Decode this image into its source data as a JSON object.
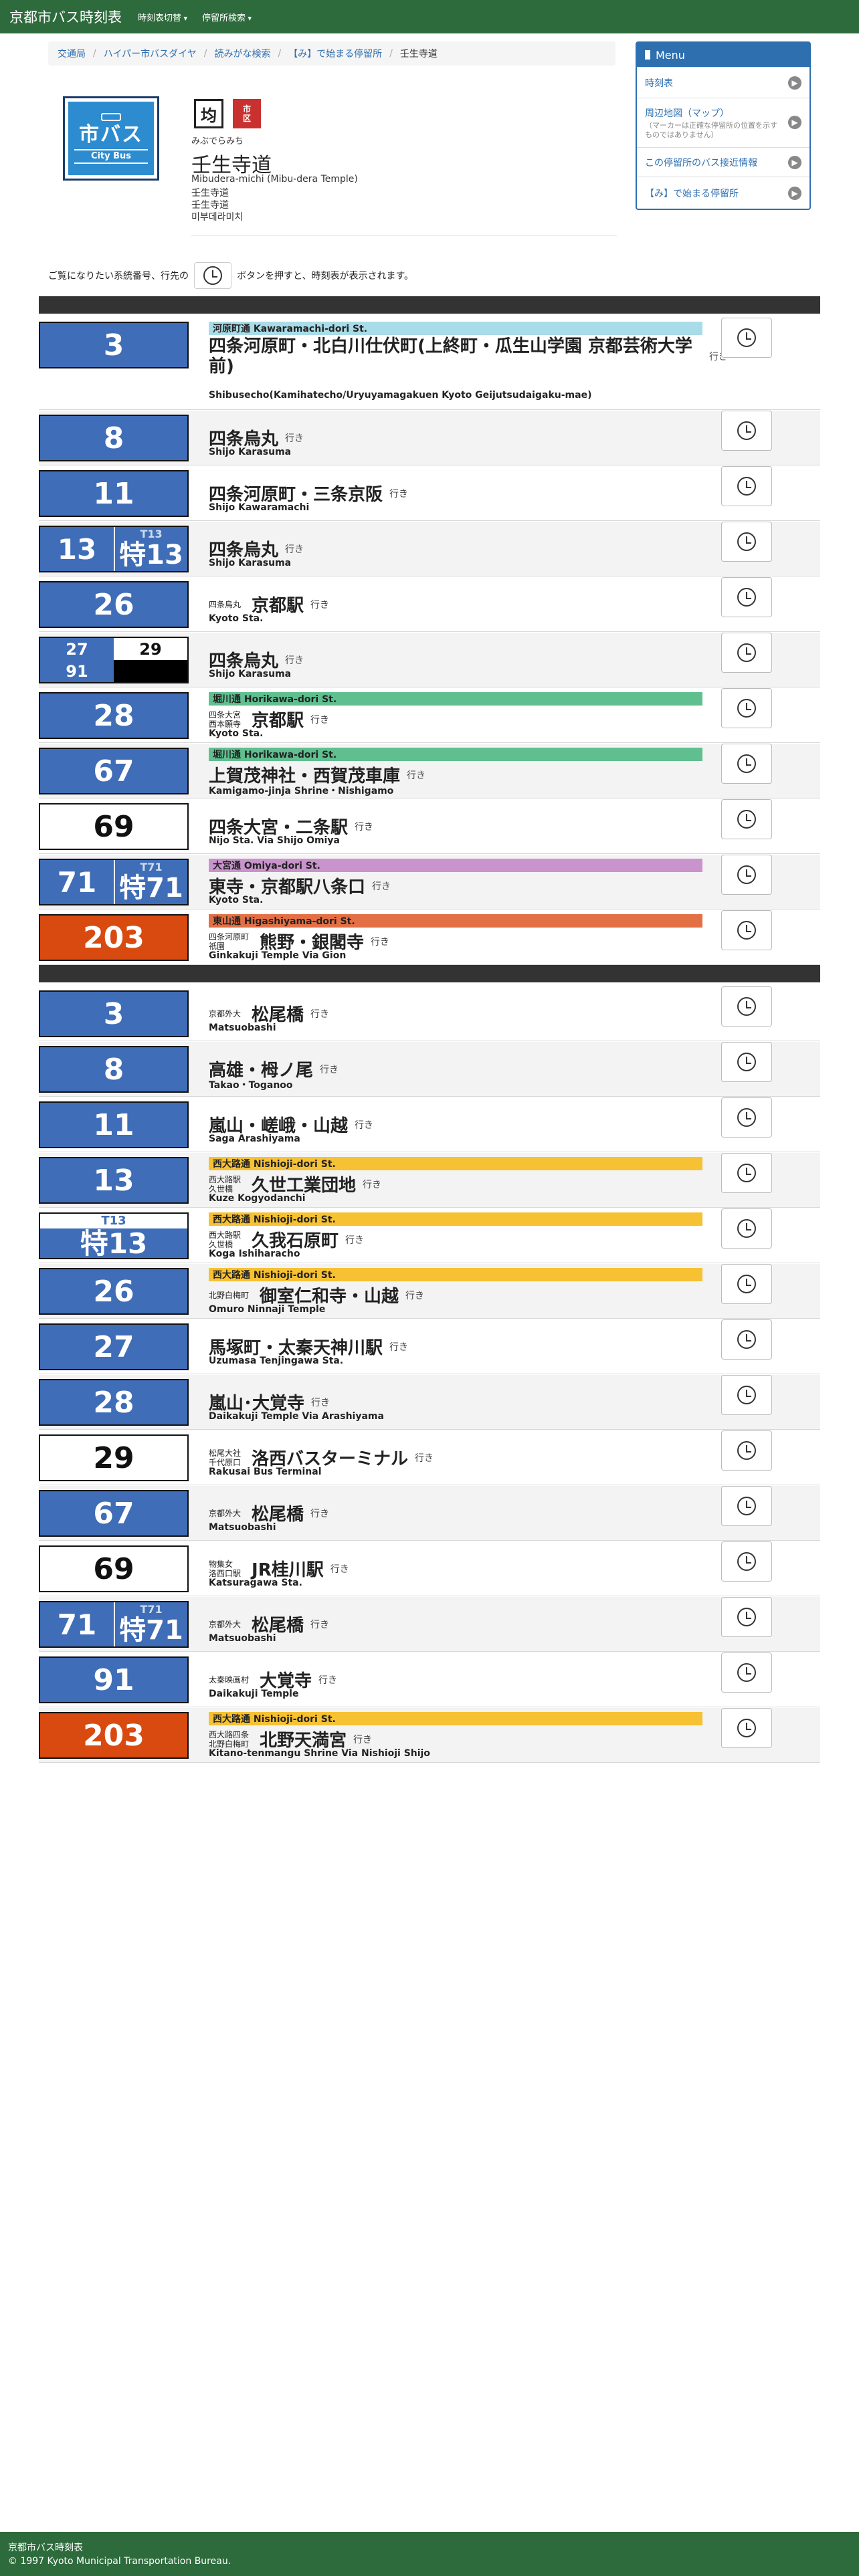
{
  "navbar": {
    "brand": "京都市バス時刻表",
    "items": [
      "時刻表切替",
      "停留所検索"
    ]
  },
  "breadcrumb": [
    "交通局",
    "ハイパー市バスダイヤ",
    "読みがな検索",
    "【み】で始まる停留所",
    "壬生寺道"
  ],
  "logo": {
    "main": "市バス",
    "sub": "City Bus"
  },
  "stop_icons": [
    "均",
    "市\n区"
  ],
  "stop": {
    "kana": "みぶでらみち",
    "name": "壬生寺道",
    "romaji": "Mibudera-michi (Mibu-dera Temple)",
    "alt": [
      "壬生寺道",
      "壬生寺道",
      "미부데라미치"
    ]
  },
  "menu": {
    "title": "Menu",
    "items": [
      {
        "label": "時刻表"
      },
      {
        "label": "周辺地図（マップ）",
        "note": "（マーカーは正確な停留所の位置を示すものではありません）"
      },
      {
        "label": "この停留所のバス接近情報"
      },
      {
        "label": "【み】で始まる停留所"
      }
    ]
  },
  "intro": {
    "before": "ご覧になりたい系統番号、行先の",
    "after": "ボタンを押すと、時刻表が表示されます。"
  },
  "yuki": "行き",
  "colors": {
    "navbar": "#2e6b3c",
    "badge_blue": "#3f6db7",
    "badge_orange": "#d84a0f",
    "via_kawaramachi": "#a9dce9",
    "via_horikawa": "#5fbf8f",
    "via_omiya": "#c993cc",
    "via_higashiyama": "#e36f45",
    "via_nishioji": "#f6c133"
  },
  "sections": [
    {
      "rows": [
        {
          "type": "single",
          "style": "blue",
          "number": "3",
          "via": "河原町通 Kawaramachi-dori St.",
          "via_color": "#a9dce9",
          "dest": "四条河原町・北白川仕伏町(上終町・瓜生山学園 京都芸術大学前)",
          "en": "Shibusecho(Kamihatecho/Uryuyamagakuen Kyoto Geijutsudaigaku-mae)"
        },
        {
          "type": "single",
          "style": "blue",
          "number": "8",
          "dest": "四条烏丸",
          "en": "Shijo Karasuma"
        },
        {
          "type": "single",
          "style": "blue",
          "number": "11",
          "dest": "四条河原町・三条京阪",
          "en": "Shijo Kawaramachi"
        },
        {
          "type": "pair",
          "a": "13",
          "b_top": "T13",
          "b": "特13",
          "dest": "四条烏丸",
          "en": "Shijo Karasuma"
        },
        {
          "type": "single",
          "style": "blue",
          "number": "26",
          "pre": "四条烏丸",
          "dest": "京都駅",
          "en": "Kyoto Sta."
        },
        {
          "type": "quad",
          "cells": [
            "27",
            "29",
            "91"
          ],
          "dest": "四条烏丸",
          "en": "Shijo Karasuma"
        },
        {
          "type": "single",
          "style": "blue",
          "number": "28",
          "via": "堀川通 Horikawa-dori St.",
          "via_color": "#5fbf8f",
          "pre": "四条大宮\n西本願寺",
          "dest": "京都駅",
          "en": "Kyoto Sta."
        },
        {
          "type": "single",
          "style": "blue",
          "number": "67",
          "via": "堀川通 Horikawa-dori St.",
          "via_color": "#5fbf8f",
          "dest": "上賀茂神社・西賀茂車庫",
          "en": "Kamigamo-jinja Shrine・Nishigamo"
        },
        {
          "type": "single",
          "style": "white",
          "number": "69",
          "dest": "四条大宮・二条駅",
          "en": "Nijo Sta. Via Shijo Omiya"
        },
        {
          "type": "pair",
          "a": "71",
          "b_top": "T71",
          "b": "特71",
          "via": "大宮通 Omiya-dori St.",
          "via_color": "#c993cc",
          "dest": "東寺・京都駅八条口",
          "en": "Kyoto Sta."
        },
        {
          "type": "single",
          "style": "orange",
          "number": "203",
          "via": "東山通 Higashiyama-dori St.",
          "via_color": "#e36f45",
          "pre": "四条河原町\n祇園",
          "dest": "熊野・銀閣寺",
          "en": "Ginkakuji Temple Via Gion"
        }
      ]
    },
    {
      "rows": [
        {
          "type": "single",
          "style": "blue",
          "number": "3",
          "pre": "京都外大",
          "dest": "松尾橋",
          "en": "Matsuobashi"
        },
        {
          "type": "single",
          "style": "blue",
          "number": "8",
          "dest": "高雄・栂ノ尾",
          "en": "Takao・Toganoo"
        },
        {
          "type": "single",
          "style": "blue",
          "number": "11",
          "dest": "嵐山・嵯峨・山越",
          "en": "Saga Arashiyama"
        },
        {
          "type": "single",
          "style": "blue",
          "number": "13",
          "via": "西大路通 Nishioji-dori St.",
          "via_color": "#f6c133",
          "pre": "西大路駅\n久世橋",
          "dest": "久世工業団地",
          "en": "Kuze Kogyodanchi"
        },
        {
          "type": "special",
          "top": "T13",
          "number": "特13",
          "via": "西大路通 Nishioji-dori St.",
          "via_color": "#f6c133",
          "pre": "西大路駅\n久世橋",
          "dest": "久我石原町",
          "en": "Koga Ishiharacho"
        },
        {
          "type": "single",
          "style": "blue",
          "number": "26",
          "via": "西大路通 Nishioji-dori St.",
          "via_color": "#f6c133",
          "pre": "北野白梅町",
          "dest": "御室仁和寺・山越",
          "en": "Omuro Ninnaji Temple"
        },
        {
          "type": "single",
          "style": "blue",
          "number": "27",
          "dest": "馬塚町・太秦天神川駅",
          "en": "Uzumasa Tenjingawa Sta."
        },
        {
          "type": "single",
          "style": "blue",
          "number": "28",
          "dest": "嵐山･大覚寺",
          "en": "Daikakuji Temple Via Arashiyama"
        },
        {
          "type": "single",
          "style": "white",
          "number": "29",
          "pre": "松尾大社\n千代原口",
          "dest": "洛西バスターミナル",
          "en": "Rakusai Bus Terminal"
        },
        {
          "type": "single",
          "style": "blue",
          "number": "67",
          "pre": "京都外大",
          "dest": "松尾橋",
          "en": "Matsuobashi"
        },
        {
          "type": "single",
          "style": "white",
          "number": "69",
          "pre": "物集女\n洛西口駅",
          "dest": "JR桂川駅",
          "en": "Katsuragawa Sta."
        },
        {
          "type": "pair",
          "a": "71",
          "b_top": "T71",
          "b": "特71",
          "pre": "京都外大",
          "dest": "松尾橋",
          "en": "Matsuobashi"
        },
        {
          "type": "single",
          "style": "blue",
          "number": "91",
          "pre": "太秦映画村",
          "dest": "大覚寺",
          "en": "Daikakuji Temple"
        },
        {
          "type": "single",
          "style": "orange",
          "number": "203",
          "via": "西大路通 Nishioji-dori St.",
          "via_color": "#f6c133",
          "pre": "西大路四条\n北野白梅町",
          "dest": "北野天満宮",
          "en": "Kitano-tenmangu Shrine Via Nishioji Shijo"
        }
      ]
    }
  ],
  "footer": {
    "line1": "京都市バス時刻表",
    "line2": "© 1997 Kyoto Municipal Transportation Bureau."
  }
}
